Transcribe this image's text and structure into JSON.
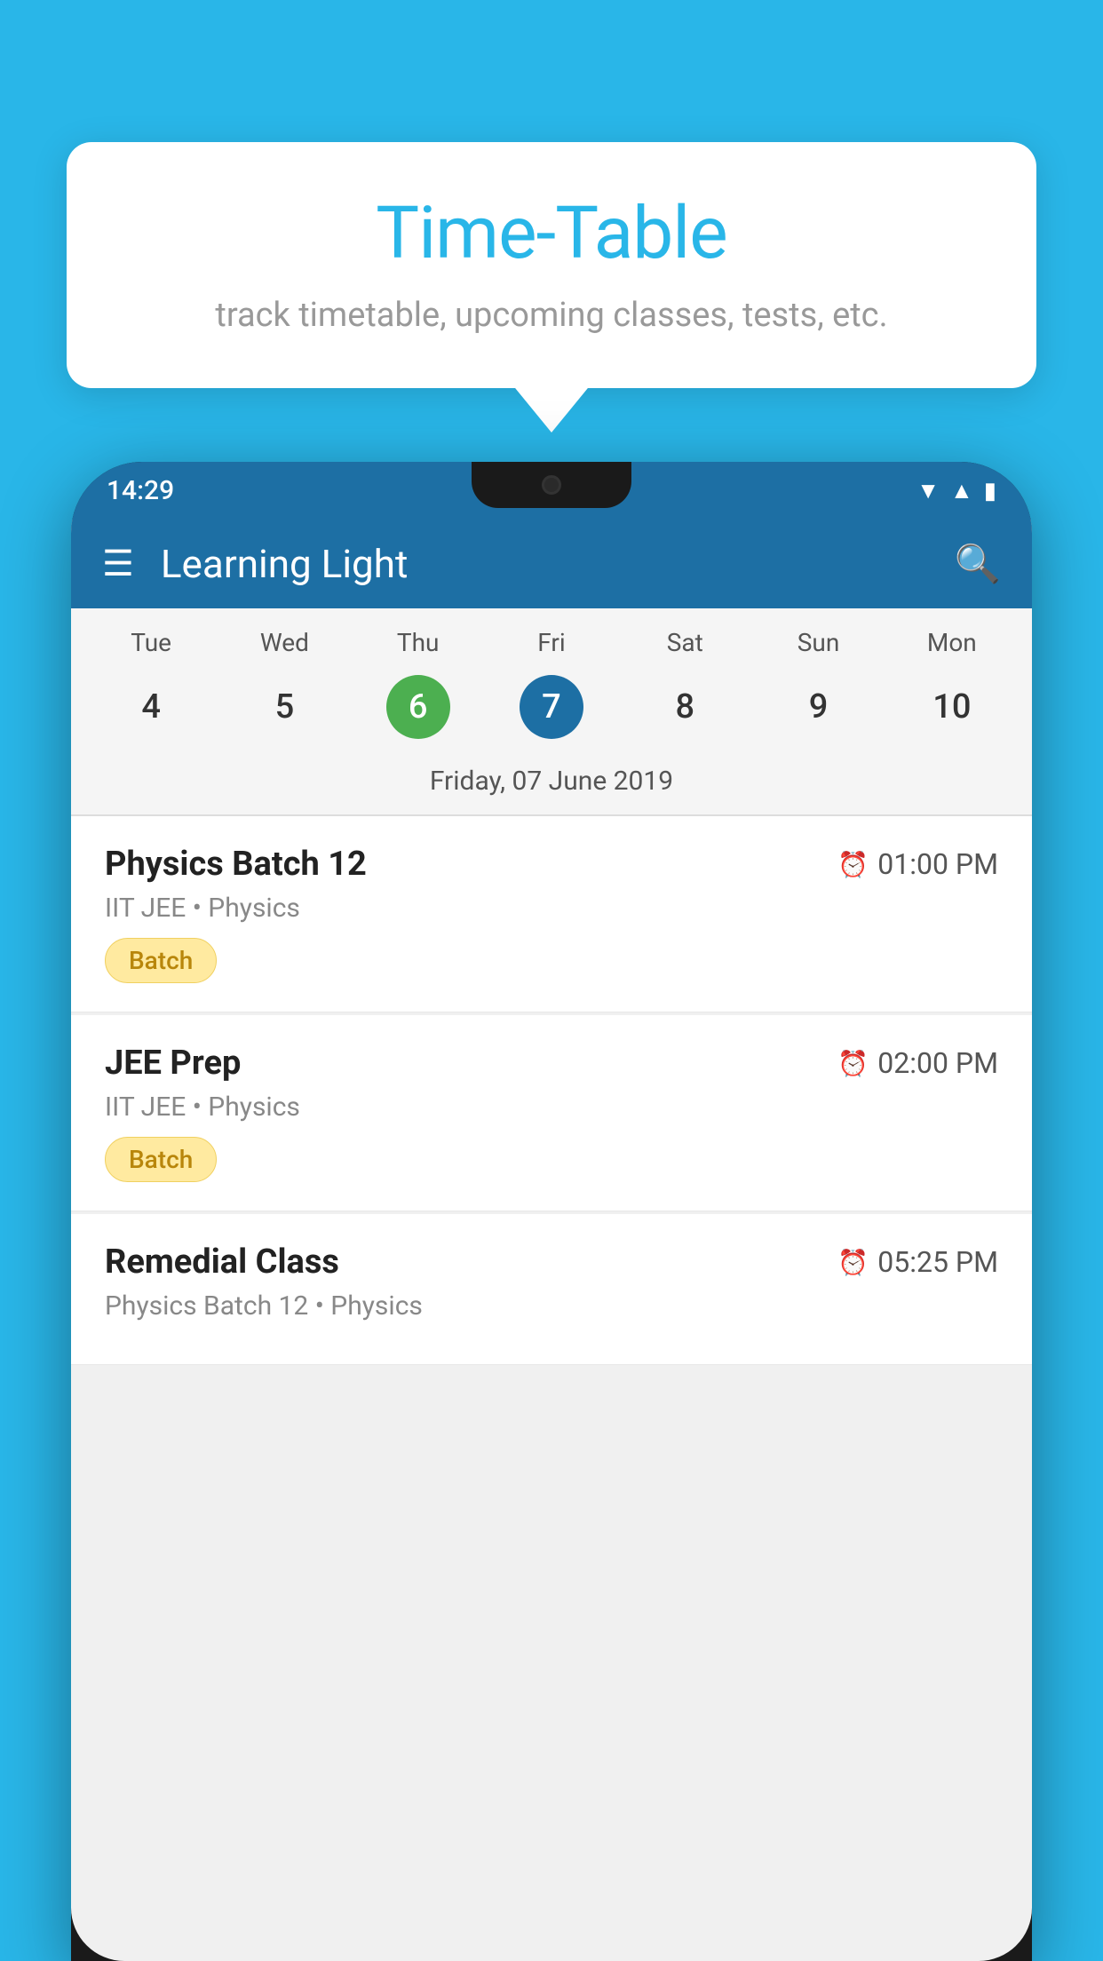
{
  "background": {
    "color": "#29b6e8"
  },
  "tooltip": {
    "title": "Time-Table",
    "subtitle": "track timetable, upcoming classes, tests, etc."
  },
  "statusBar": {
    "time": "14:29"
  },
  "appBar": {
    "title": "Learning Light",
    "hamburgerLabel": "☰",
    "searchLabel": "🔍"
  },
  "calendar": {
    "days": [
      {
        "name": "Tue",
        "number": "4",
        "state": "normal"
      },
      {
        "name": "Wed",
        "number": "5",
        "state": "normal"
      },
      {
        "name": "Thu",
        "number": "6",
        "state": "today"
      },
      {
        "name": "Fri",
        "number": "7",
        "state": "selected"
      },
      {
        "name": "Sat",
        "number": "8",
        "state": "normal"
      },
      {
        "name": "Sun",
        "number": "9",
        "state": "normal"
      },
      {
        "name": "Mon",
        "number": "10",
        "state": "normal"
      }
    ],
    "selectedDateLabel": "Friday, 07 June 2019"
  },
  "schedule": [
    {
      "title": "Physics Batch 12",
      "time": "01:00 PM",
      "subtitle": "IIT JEE • Physics",
      "badge": "Batch"
    },
    {
      "title": "JEE Prep",
      "time": "02:00 PM",
      "subtitle": "IIT JEE • Physics",
      "badge": "Batch"
    },
    {
      "title": "Remedial Class",
      "time": "05:25 PM",
      "subtitle": "Physics Batch 12 • Physics",
      "badge": null
    }
  ]
}
